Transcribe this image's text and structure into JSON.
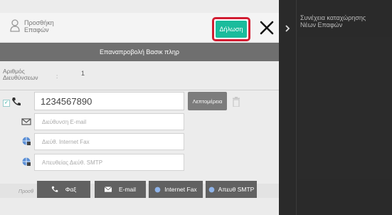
{
  "header": {
    "title_line1": "Προσθήκη",
    "title_line2": "Επαφών",
    "declare_label": "Δήλωση"
  },
  "revert_label": "Επαναπροβολή Βασικ πληρ",
  "address_count": {
    "label_line1": "Αριθμός",
    "label_line2": "Διευθύνσεων",
    "colon": ":",
    "value": "1"
  },
  "phone": {
    "value": "1234567890",
    "details_label": "Λεπτομέρεια"
  },
  "fields": {
    "email_placeholder": "Διεύθυνση E-mail",
    "ifax_placeholder": "Διεύθ. Internet Fax",
    "smtp_placeholder": "Απευθείας Διεύθ. SMTP"
  },
  "bottom": {
    "prefix": "Προσθ",
    "tabs": [
      {
        "label": "Φαξ",
        "icon": "phone-icon"
      },
      {
        "label": "E-mail",
        "icon": "mail-icon"
      },
      {
        "label": "Internet Fax",
        "icon": "globe-icon"
      },
      {
        "label": "Απευθ SMTP",
        "icon": "globe-icon"
      }
    ]
  },
  "right_panel": {
    "line1": "Συνέχεια καταχώρησης",
    "line2": "Νέων Επαφών"
  },
  "colors": {
    "accent": "#1abc9c",
    "highlight": "#d31d32"
  }
}
